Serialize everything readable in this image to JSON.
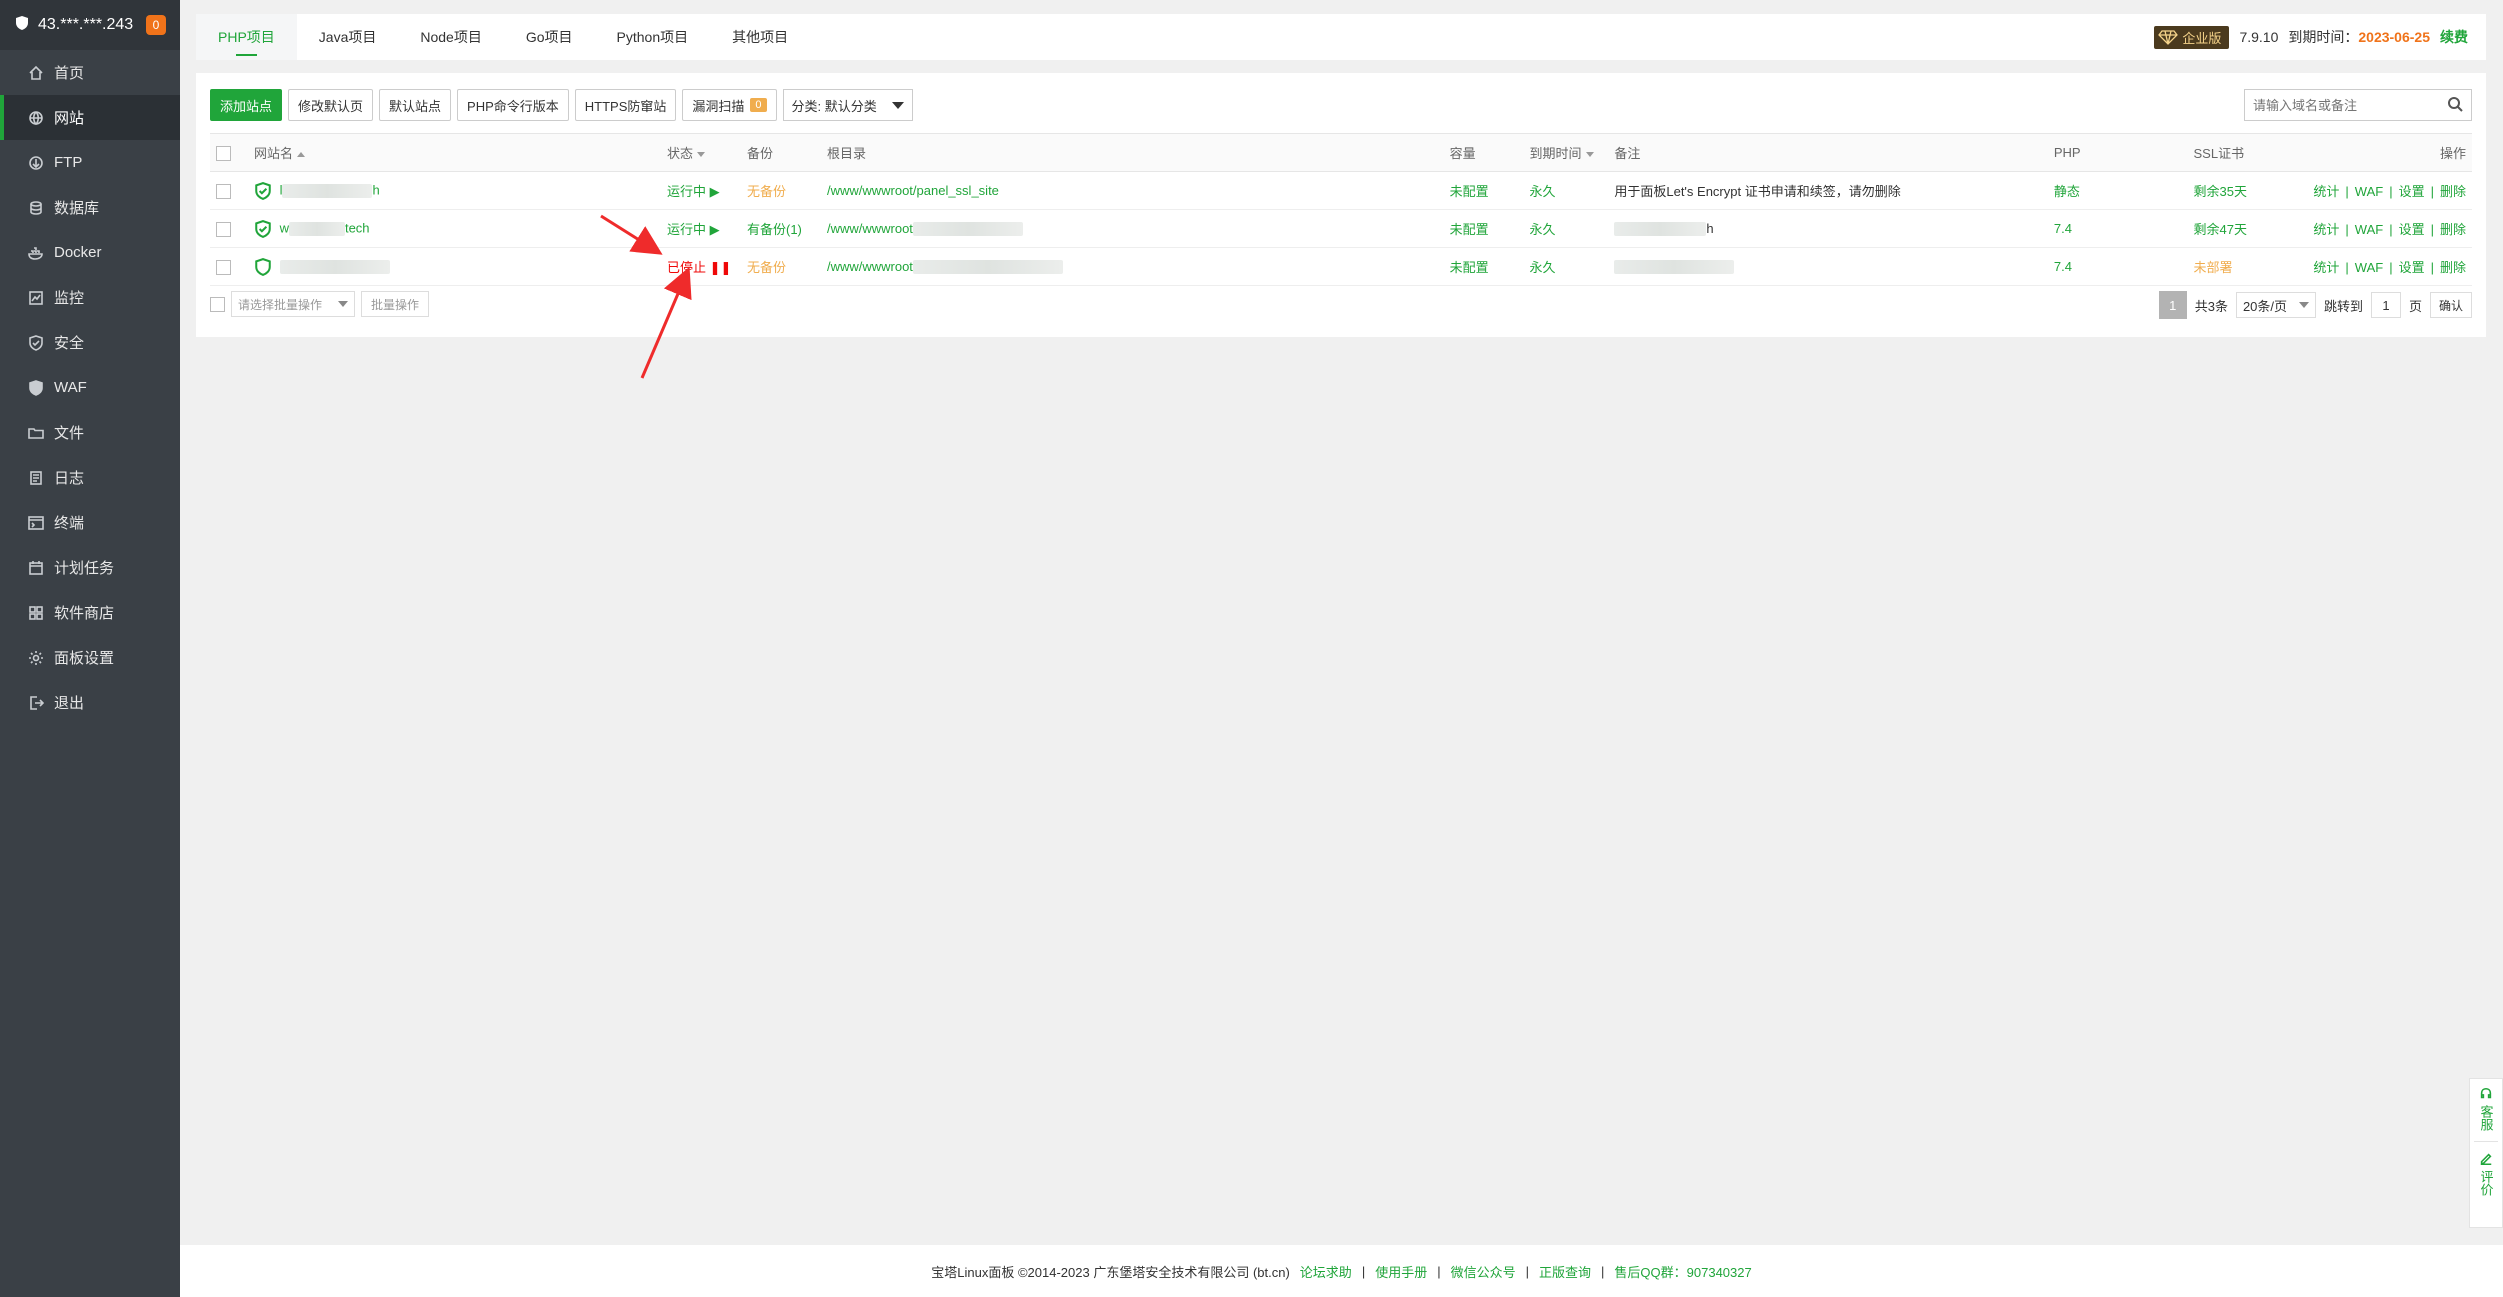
{
  "sidebar": {
    "ip": "43.***.***.243",
    "badge": "0",
    "items": [
      {
        "label": "首页",
        "icon": "home-icon"
      },
      {
        "label": "网站",
        "icon": "globe-icon",
        "active": true
      },
      {
        "label": "FTP",
        "icon": "ftp-icon"
      },
      {
        "label": "数据库",
        "icon": "database-icon"
      },
      {
        "label": "Docker",
        "icon": "docker-icon"
      },
      {
        "label": "监控",
        "icon": "monitor-icon"
      },
      {
        "label": "安全",
        "icon": "shield-icon"
      },
      {
        "label": "WAF",
        "icon": "waf-icon"
      },
      {
        "label": "文件",
        "icon": "folder-icon"
      },
      {
        "label": "日志",
        "icon": "log-icon"
      },
      {
        "label": "终端",
        "icon": "terminal-icon"
      },
      {
        "label": "计划任务",
        "icon": "calendar-icon"
      },
      {
        "label": "软件商店",
        "icon": "grid-icon"
      },
      {
        "label": "面板设置",
        "icon": "gear-icon"
      },
      {
        "label": "退出",
        "icon": "logout-icon"
      }
    ]
  },
  "topbar": {
    "tabs": [
      "PHP项目",
      "Java项目",
      "Node项目",
      "Go项目",
      "Python项目",
      "其他项目"
    ],
    "edition": "企业版",
    "version": "7.9.10",
    "expire_label": "到期时间：",
    "expire_date": "2023-06-25",
    "renew": "续费"
  },
  "toolbar": {
    "add_site": "添加站点",
    "modify_default_page": "修改默认页",
    "default_site": "默认站点",
    "php_cli_version": "PHP命令行版本",
    "https_defense": "HTTPS防窜站",
    "vuln_scan": "漏洞扫描",
    "vuln_count": "0",
    "category": "分类: 默认分类",
    "search_placeholder": "请输入域名或备注"
  },
  "table": {
    "headers": {
      "name": "网站名",
      "status": "状态",
      "backup": "备份",
      "root": "根目录",
      "quota": "容量",
      "expire": "到期时间",
      "remark": "备注",
      "php": "PHP",
      "ssl": "SSL证书",
      "ops": "操作"
    },
    "rows": [
      {
        "name_prefix": "l",
        "name_suffix": "h",
        "status": "运行中 ▶",
        "backup": "无备份",
        "root": "/www/wwwroot/panel_ssl_site",
        "quota": "未配置",
        "expire": "永久",
        "remark": "用于面板Let's Encrypt 证书申请和续签，请勿删除",
        "php": "静态",
        "ssl": "剩余35天"
      },
      {
        "name_prefix": "w",
        "name_suffix": "tech",
        "status": "运行中 ▶",
        "backup": "有备份(1)",
        "root": "/www/wwwroot",
        "quota": "未配置",
        "expire": "永久",
        "remark": "h",
        "php": "7.4",
        "ssl": "剩余47天"
      },
      {
        "name_prefix": "",
        "name_suffix": "",
        "status": "已停止 ❚❚",
        "backup": "无备份",
        "root": "/www/wwwroot",
        "quota": "未配置",
        "expire": "永久",
        "remark": "",
        "php": "7.4",
        "ssl": "未部署"
      }
    ],
    "ops": [
      "统计",
      "WAF",
      "设置",
      "删除"
    ]
  },
  "batch": {
    "select_placeholder": "请选择批量操作",
    "button": "批量操作"
  },
  "pager": {
    "current": "1",
    "total": "共3条",
    "per_page": "20条/页",
    "jump_label": "跳转到",
    "jump_value": "1",
    "page_unit": "页",
    "confirm": "确认"
  },
  "footer": {
    "copyright": "宝塔Linux面板 ©2014-2023 广东堡塔安全技术有限公司 (bt.cn)",
    "links": [
      "论坛求助",
      "使用手册",
      "微信公众号",
      "正版查询",
      "售后QQ群：907340327"
    ]
  },
  "float": {
    "service": "客服",
    "review": "评价"
  },
  "colors": {
    "accent": "#20a53a",
    "warning": "#f0ad4e",
    "danger": "#ef0808",
    "sidebar_bg": "#3a4046"
  }
}
